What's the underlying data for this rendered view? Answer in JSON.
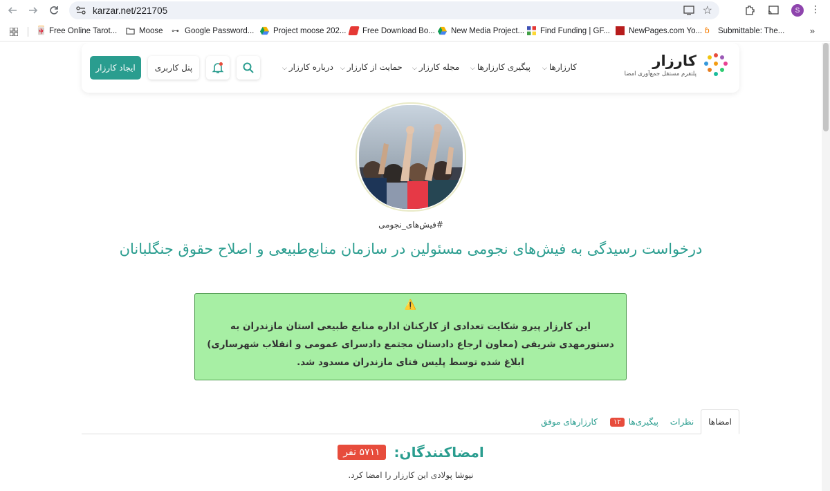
{
  "browser": {
    "url": "karzar.net/221705",
    "profile_initial": "S",
    "bookmarks": [
      {
        "label": "Free Online Tarot...",
        "icon": "tarot-icon"
      },
      {
        "label": "Moose",
        "icon": "folder-icon"
      },
      {
        "label": "Google Password...",
        "icon": "key-icon"
      },
      {
        "label": "Project moose 202...",
        "icon": "drive-icon"
      },
      {
        "label": "Free Download Bo...",
        "icon": "book-icon"
      },
      {
        "label": "New Media Project...",
        "icon": "drive-icon"
      },
      {
        "label": "Find Funding | GF...",
        "icon": "grid-icon"
      },
      {
        "label": "NewPages.com Yo...",
        "icon": "newpages-icon"
      },
      {
        "label": "Submittable: The...",
        "icon": "submittable-icon"
      }
    ]
  },
  "header": {
    "create_label": "ایجاد کارزار",
    "panel_label": "پنل کاربری",
    "menu": [
      {
        "label": "کارزارها"
      },
      {
        "label": "پیگیری کارزارها"
      },
      {
        "label": "مجله کارزار"
      },
      {
        "label": "حمایت از کارزار"
      },
      {
        "label": "درباره کارزار"
      }
    ],
    "logo_name": "کارزار",
    "logo_tagline": "پلتفرم مستقل جمع‌آوری امضا",
    "colors": {
      "accent": "#2a9d8f",
      "badge": "#e74c3c"
    }
  },
  "campaign": {
    "hashtag": "#فیش‌های_نجومی",
    "title": "درخواست رسیدگی به فیش‌های نجومی مسئولین در سازمان منابع‌طبیعی و اصلاح حقوق جنگلبانان",
    "alert_icon": "⚠️",
    "alert_text": "این کارزار پیرو شکایت تعدادی از کارکنان اداره منابع طبیعی استان مازندران به دستورمهدی شریفی (معاون ارجاع دادستان مجتمع دادسرای عمومی و انقلاب شهرساری) ابلاغ شده توسط پلیس فتای مازندران مسدود شد."
  },
  "tabs": {
    "signatures": "امضاها",
    "comments": "نظرات",
    "followups": "پیگیری‌ها",
    "followups_count": "۱۲",
    "successful": "کارزارهای موفق"
  },
  "signers": {
    "title": "امضاکنندگان:",
    "count": "۵۷۱۱ نفر",
    "recent": "نیوشا پولادی این کارزار را امضا کرد."
  }
}
